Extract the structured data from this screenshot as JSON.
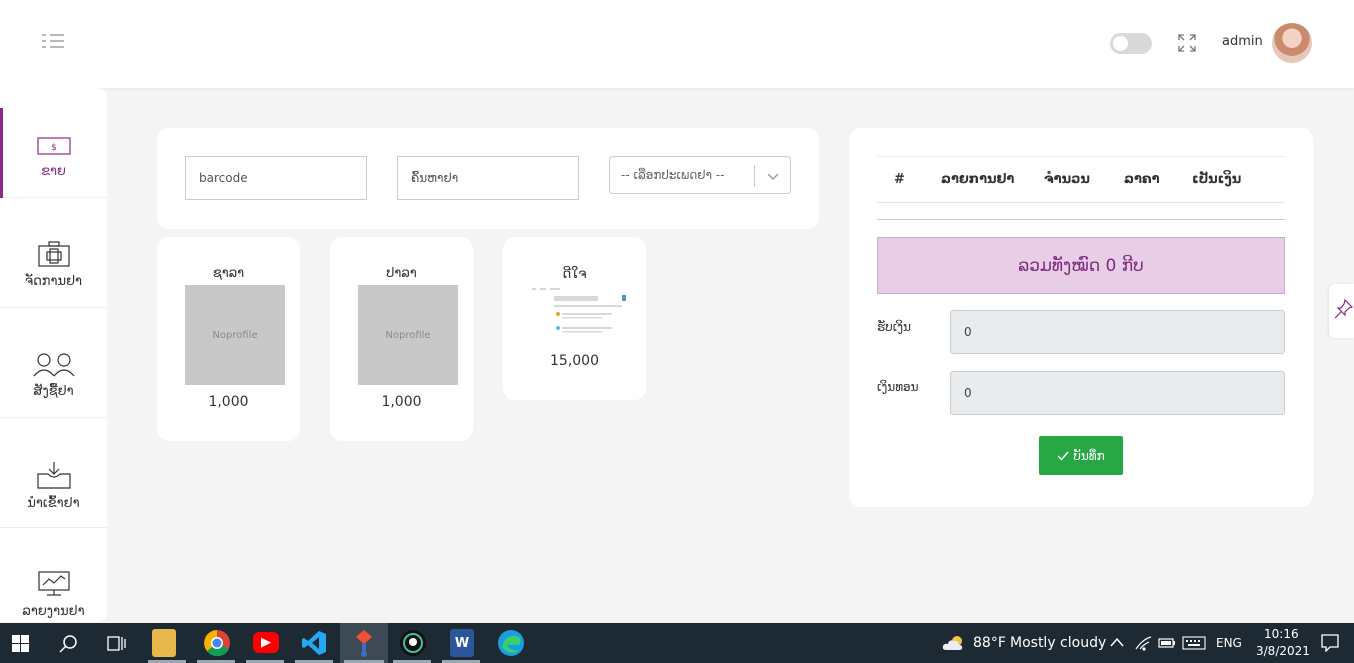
{
  "topbar": {
    "admin_name": "admin"
  },
  "sidebar": {
    "items": [
      {
        "label": "ຂາຍ",
        "icon": "money-icon",
        "active": true
      },
      {
        "label": "ຈັດການຢາ",
        "icon": "medical-kit-icon",
        "active": false
      },
      {
        "label": "ສັງຊື້ຢາ",
        "icon": "people-icon",
        "active": false
      },
      {
        "label": "ນຳເຂົ້າຢາ",
        "icon": "inbox-icon",
        "active": false
      },
      {
        "label": "ລາຍງານຢາ",
        "icon": "monitor-chart-icon",
        "active": false
      }
    ]
  },
  "filters": {
    "barcode_placeholder": "barcode",
    "search_placeholder": "ຄົ້ນຫາຢາ",
    "category_placeholder": "-- ເລືອກປະເພດຢາ --"
  },
  "products": [
    {
      "name": "ຊາລາ",
      "image_text": "Noprofile",
      "price": "1,000",
      "has_image": false
    },
    {
      "name": "ປາລາ",
      "image_text": "Noprofile",
      "price": "1,000",
      "has_image": false
    },
    {
      "name": "ດີໃຈ",
      "image_text": "",
      "price": "15,000",
      "has_image": true
    }
  ],
  "cart": {
    "columns": [
      "#",
      "ລາຍການຢາ",
      "ຈຳນວນ",
      "ລາຄາ",
      "ເປັນເງິນ"
    ],
    "total_label": "ລວມທັງໝົດ 0 ກີບ",
    "received_label": "ຮັບເງິນ",
    "received_value": "0",
    "change_label": "ເງິນທອນ",
    "change_value": "0",
    "save_label": "ບັນທຶກ"
  },
  "taskbar": {
    "apps": [
      "start-icon",
      "search-icon",
      "task-view-icon",
      "file-explorer-icon",
      "chrome-icon",
      "youtube-icon",
      "vscode-icon",
      "git-icon",
      "github-icon",
      "word-icon",
      "edge-icon"
    ],
    "weather_temp": "88°F",
    "weather_text": "Mostly cloudy",
    "language": "ENG",
    "time": "10:16",
    "date": "3/8/2021"
  },
  "colors": {
    "accent": "#8a2a8a",
    "total_bg": "#e7cde6",
    "save_button": "#28a745",
    "taskbar": "#1e2a33"
  }
}
